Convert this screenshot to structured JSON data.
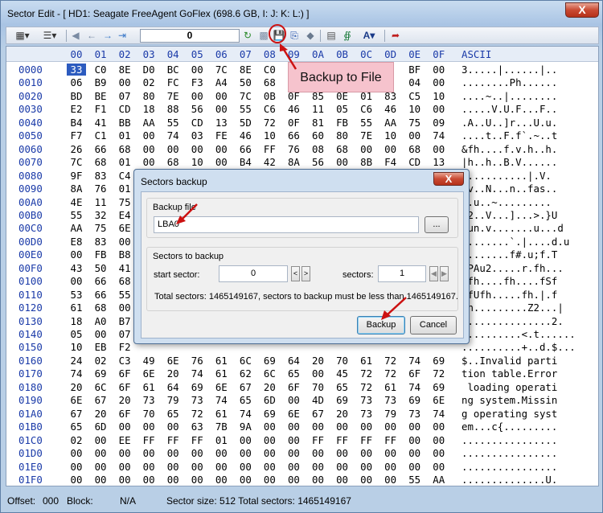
{
  "window": {
    "title": "Sector Edit - [ HD1: Seagate FreeAgent GoFlex (698.6 GB, I: J: K: L:) ]",
    "close_label": "X"
  },
  "toolbar": {
    "sector_value": "0"
  },
  "editor": {
    "hex_header": [
      "00",
      "01",
      "02",
      "03",
      "04",
      "05",
      "06",
      "07",
      "08",
      "09",
      "0A",
      "0B",
      "0C",
      "0D",
      "0E",
      "0F"
    ],
    "ascii_header": "ASCII",
    "rows": [
      {
        "offset": "0000",
        "bytes": [
          "33",
          "C0",
          "8E",
          "D0",
          "BC",
          "00",
          "7C",
          "8E",
          "C0",
          "8E",
          "D8",
          "",
          "",
          "",
          "BF",
          "00"
        ],
        "ascii": "3.....|......|.."
      },
      {
        "offset": "0010",
        "bytes": [
          "06",
          "B9",
          "00",
          "02",
          "FC",
          "F3",
          "A4",
          "50",
          "68",
          "1C",
          "",
          "",
          "",
          "",
          "04",
          "00"
        ],
        "ascii": "........Ph......"
      },
      {
        "offset": "0020",
        "bytes": [
          "BD",
          "BE",
          "07",
          "80",
          "7E",
          "00",
          "00",
          "7C",
          "0B",
          "0F",
          "85",
          "0E",
          "01",
          "83",
          "C5",
          "10"
        ],
        "ascii": "....~..|........"
      },
      {
        "offset": "0030",
        "bytes": [
          "E2",
          "F1",
          "CD",
          "18",
          "88",
          "56",
          "00",
          "55",
          "C6",
          "46",
          "11",
          "05",
          "C6",
          "46",
          "10",
          "00"
        ],
        "ascii": ".....V.U.F...F.."
      },
      {
        "offset": "0040",
        "bytes": [
          "B4",
          "41",
          "BB",
          "AA",
          "55",
          "CD",
          "13",
          "5D",
          "72",
          "0F",
          "81",
          "FB",
          "55",
          "AA",
          "75",
          "09"
        ],
        "ascii": ".A..U..]r...U.u."
      },
      {
        "offset": "0050",
        "bytes": [
          "F7",
          "C1",
          "01",
          "00",
          "74",
          "03",
          "FE",
          "46",
          "10",
          "66",
          "60",
          "80",
          "7E",
          "10",
          "00",
          "74"
        ],
        "ascii": "....t..F.f`.~..t"
      },
      {
        "offset": "0060",
        "bytes": [
          "26",
          "66",
          "68",
          "00",
          "00",
          "00",
          "00",
          "66",
          "FF",
          "76",
          "08",
          "68",
          "00",
          "00",
          "68",
          "00"
        ],
        "ascii": "&fh....f.v.h..h."
      },
      {
        "offset": "0070",
        "bytes": [
          "7C",
          "68",
          "01",
          "00",
          "68",
          "10",
          "00",
          "B4",
          "42",
          "8A",
          "56",
          "00",
          "8B",
          "F4",
          "CD",
          "13"
        ],
        "ascii": "|h..h..B.V......"
      },
      {
        "offset": "0080",
        "bytes": [
          "9F",
          "83",
          "C4",
          "",
          "",
          "",
          "",
          "",
          "",
          "",
          "",
          "",
          "",
          "",
          "",
          "",
          "",
          ""
        ],
        "ascii": "...........|.V."
      },
      {
        "offset": "0090",
        "bytes": [
          "8A",
          "76",
          "01",
          "",
          "",
          "",
          "",
          "",
          "",
          "",
          "",
          "",
          "",
          "",
          "",
          "",
          "",
          ""
        ],
        "ascii": ".v..N...n..fas.."
      },
      {
        "offset": "00A0",
        "bytes": [
          "4E",
          "11",
          "75",
          "",
          "",
          "",
          "",
          "",
          "",
          "",
          "",
          "",
          "",
          "",
          "",
          "",
          "",
          ""
        ],
        "ascii": "N.u..~........."
      },
      {
        "offset": "00B0",
        "bytes": [
          "55",
          "32",
          "E4",
          "",
          "",
          "",
          "",
          "",
          "",
          "",
          "",
          "",
          "",
          "",
          "",
          "",
          "",
          ""
        ],
        "ascii": "U2..V...]...>.}U"
      },
      {
        "offset": "00C0",
        "bytes": [
          "AA",
          "75",
          "6E",
          "",
          "",
          "",
          "",
          "",
          "",
          "",
          "",
          "",
          "",
          "",
          "",
          "",
          "",
          ""
        ],
        "ascii": ".un.v.......u...d"
      },
      {
        "offset": "00D0",
        "bytes": [
          "E8",
          "83",
          "00",
          "",
          "",
          "",
          "",
          "",
          "",
          "",
          "",
          "",
          "",
          "",
          "",
          "",
          "",
          ""
        ],
        "ascii": "........`.|....d.u"
      },
      {
        "offset": "00E0",
        "bytes": [
          "00",
          "FB",
          "B8",
          "",
          "",
          "",
          "",
          "",
          "",
          "",
          "",
          "",
          "",
          "",
          "",
          "",
          "",
          ""
        ],
        "ascii": "........f#.u;f.T"
      },
      {
        "offset": "00F0",
        "bytes": [
          "43",
          "50",
          "41",
          "",
          "",
          "",
          "",
          "",
          "",
          "",
          "",
          "",
          "",
          "",
          "",
          "",
          "",
          ""
        ],
        "ascii": "CPAu2.....r.fh..."
      },
      {
        "offset": "0100",
        "bytes": [
          "00",
          "66",
          "68",
          "",
          "",
          "",
          "",
          "",
          "",
          "",
          "",
          "",
          "",
          "",
          "",
          "",
          "",
          ""
        ],
        "ascii": ".fh....fh....fSf"
      },
      {
        "offset": "0110",
        "bytes": [
          "53",
          "66",
          "55",
          "",
          "",
          "",
          "",
          "",
          "",
          "",
          "",
          "",
          "",
          "",
          "",
          "",
          "",
          ""
        ],
        "ascii": "SfUfh.....fh.|.f"
      },
      {
        "offset": "0120",
        "bytes": [
          "61",
          "68",
          "00",
          "",
          "",
          "",
          "",
          "",
          "",
          "",
          "",
          "",
          "",
          "",
          "",
          "",
          "",
          ""
        ],
        "ascii": "ah.........Z2...|"
      },
      {
        "offset": "0130",
        "bytes": [
          "18",
          "A0",
          "B7",
          "",
          "",
          "",
          "",
          "",
          "",
          "",
          "",
          "",
          "",
          "",
          "",
          "",
          "",
          ""
        ],
        "ascii": "...............2."
      },
      {
        "offset": "0140",
        "bytes": [
          "05",
          "00",
          "07",
          "",
          "",
          "",
          "",
          "",
          "",
          "",
          "",
          "",
          "",
          "",
          "",
          "",
          "",
          ""
        ],
        "ascii": "..........<.t......"
      },
      {
        "offset": "0150",
        "bytes": [
          "10",
          "EB",
          "F2",
          "",
          "",
          "",
          "",
          "",
          "",
          "",
          "",
          "",
          "",
          "",
          "",
          "",
          "",
          ""
        ],
        "ascii": "..........+..d.$..."
      },
      {
        "offset": "0160",
        "bytes": [
          "24",
          "02",
          "C3",
          "49",
          "6E",
          "76",
          "61",
          "6C",
          "69",
          "64",
          "20",
          "70",
          "61",
          "72",
          "74",
          "69"
        ],
        "ascii": "$..Invalid parti"
      },
      {
        "offset": "0170",
        "bytes": [
          "74",
          "69",
          "6F",
          "6E",
          "20",
          "74",
          "61",
          "62",
          "6C",
          "65",
          "00",
          "45",
          "72",
          "72",
          "6F",
          "72"
        ],
        "ascii": "tion table.Error"
      },
      {
        "offset": "0180",
        "bytes": [
          "20",
          "6C",
          "6F",
          "61",
          "64",
          "69",
          "6E",
          "67",
          "20",
          "6F",
          "70",
          "65",
          "72",
          "61",
          "74",
          "69"
        ],
        "ascii": " loading operati"
      },
      {
        "offset": "0190",
        "bytes": [
          "6E",
          "67",
          "20",
          "73",
          "79",
          "73",
          "74",
          "65",
          "6D",
          "00",
          "4D",
          "69",
          "73",
          "73",
          "69",
          "6E"
        ],
        "ascii": "ng system.Missin"
      },
      {
        "offset": "01A0",
        "bytes": [
          "67",
          "20",
          "6F",
          "70",
          "65",
          "72",
          "61",
          "74",
          "69",
          "6E",
          "67",
          "20",
          "73",
          "79",
          "73",
          "74"
        ],
        "ascii": "g operating syst"
      },
      {
        "offset": "01B0",
        "bytes": [
          "65",
          "6D",
          "00",
          "00",
          "00",
          "63",
          "7B",
          "9A",
          "00",
          "00",
          "00",
          "00",
          "00",
          "00",
          "00",
          "00"
        ],
        "ascii": "em...c{........."
      },
      {
        "offset": "01C0",
        "bytes": [
          "02",
          "00",
          "EE",
          "FF",
          "FF",
          "FF",
          "01",
          "00",
          "00",
          "00",
          "FF",
          "FF",
          "FF",
          "FF",
          "00",
          "00"
        ],
        "ascii": "................"
      },
      {
        "offset": "01D0",
        "bytes": [
          "00",
          "00",
          "00",
          "00",
          "00",
          "00",
          "00",
          "00",
          "00",
          "00",
          "00",
          "00",
          "00",
          "00",
          "00",
          "00"
        ],
        "ascii": "................"
      },
      {
        "offset": "01E0",
        "bytes": [
          "00",
          "00",
          "00",
          "00",
          "00",
          "00",
          "00",
          "00",
          "00",
          "00",
          "00",
          "00",
          "00",
          "00",
          "00",
          "00"
        ],
        "ascii": "................"
      },
      {
        "offset": "01F0",
        "bytes": [
          "00",
          "00",
          "00",
          "00",
          "00",
          "00",
          "00",
          "00",
          "00",
          "00",
          "00",
          "00",
          "00",
          "00",
          "55",
          "AA"
        ],
        "ascii": "..............U."
      }
    ]
  },
  "status": {
    "offset_label": "Offset:",
    "offset_value": "000",
    "block_label": "Block:",
    "block_value": "N/A",
    "sector_size": "Sector size:  512 Total sectors:  1465149167"
  },
  "callout": {
    "text": "Backup to File"
  },
  "dialog": {
    "title": "Sectors backup",
    "close_label": "X",
    "backup_file_label": "Backup file",
    "backup_file_value": "LBA0",
    "browse_label": "...",
    "sectors_group_label": "Sectors to backup",
    "start_sector_label": "start sector:",
    "start_sector_value": "0",
    "sectors_label": "sectors:",
    "sectors_value": "1",
    "spin_left": "<",
    "spin_right": ">",
    "total_text": "Total sectors: 1465149167, sectors to backup must be less than 1465149167.",
    "backup_button": "Backup",
    "cancel_button": "Cancel"
  },
  "colors": {
    "accent": "#cc1111",
    "callout_bg": "#f6c3cd",
    "offset_text": "#1a3aa8"
  }
}
